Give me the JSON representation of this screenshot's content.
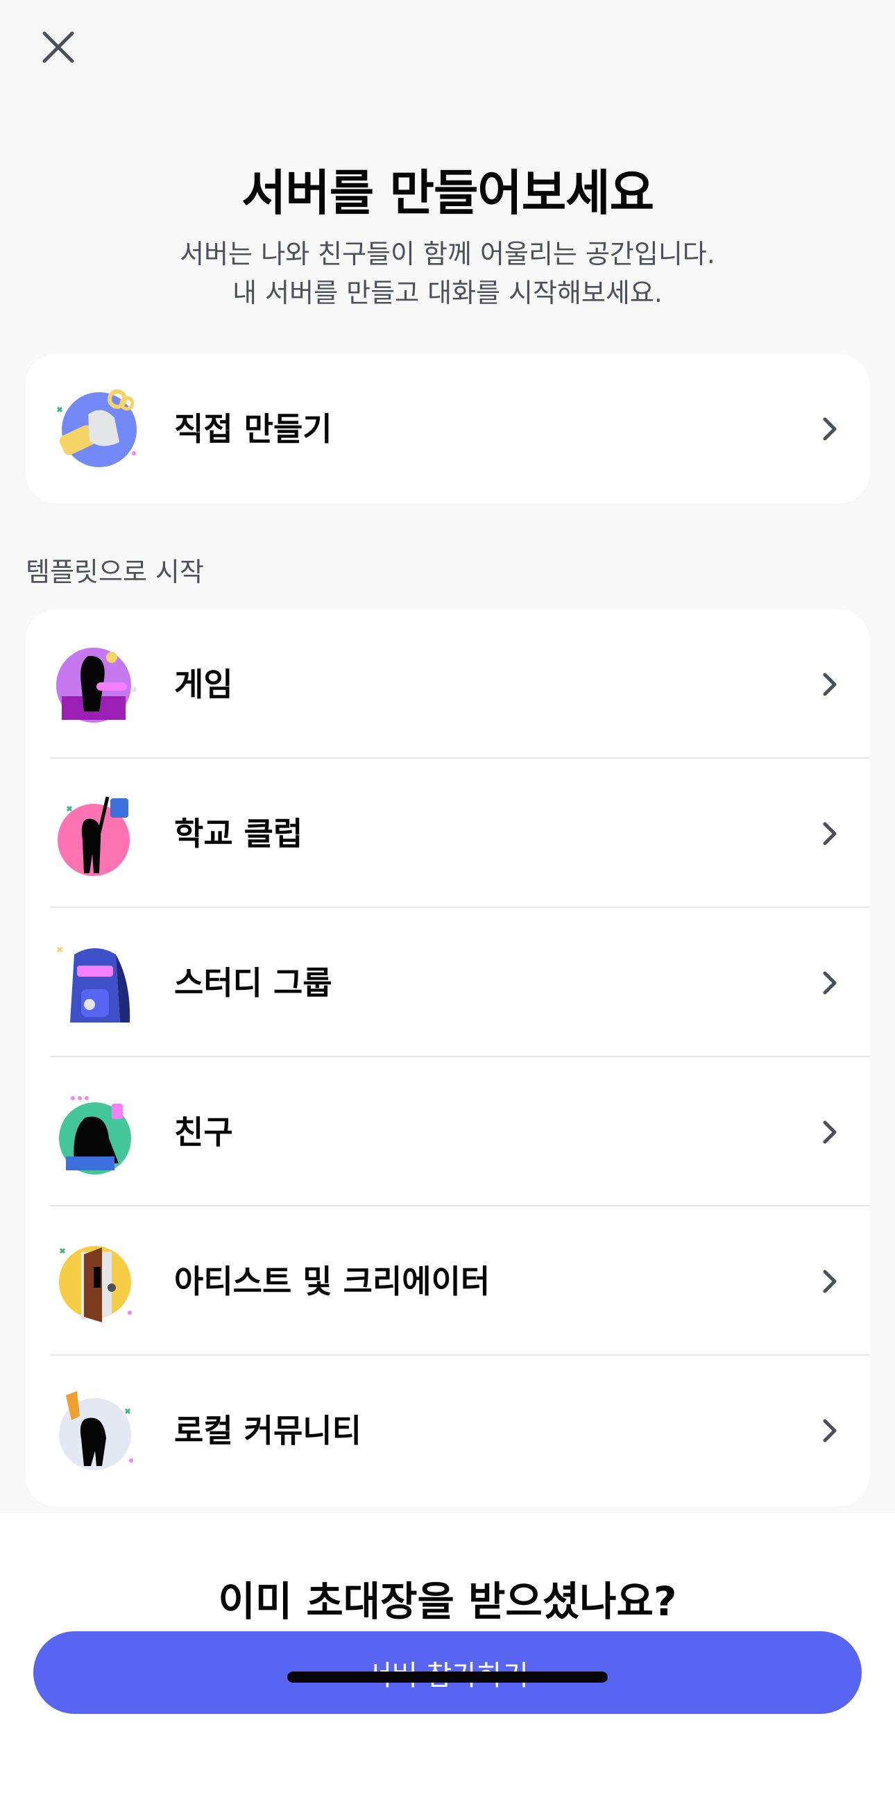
{
  "header": {
    "close_icon": "close-icon",
    "title": "서버를 만들어보세요",
    "subtitle_line1": "서버는 나와 친구들이 함께 어울리는 공간입니다.",
    "subtitle_line2": "내 서버를 만들고 대화를 시작해보세요."
  },
  "create": {
    "label": "직접 만들기",
    "icon": "create-own-illustration-icon"
  },
  "templates": {
    "section_label": "템플릿으로 시작",
    "items": [
      {
        "label": "게임",
        "icon": "gaming-illustration-icon"
      },
      {
        "label": "학교 클럽",
        "icon": "school-club-illustration-icon"
      },
      {
        "label": "스터디 그룹",
        "icon": "study-group-illustration-icon"
      },
      {
        "label": "친구",
        "icon": "friends-illustration-icon"
      },
      {
        "label": "아티스트 및 크리에이터",
        "icon": "artists-creators-illustration-icon"
      },
      {
        "label": "로컬 커뮤니티",
        "icon": "local-community-illustration-icon"
      }
    ]
  },
  "footer": {
    "invite_question": "이미 초대장을 받으셨나요?",
    "join_button_label": "서버 참가하기"
  },
  "colors": {
    "accent": "#5865f2",
    "background": "#f8f8f9",
    "card": "#ffffff",
    "divider": "#e3e5e8"
  }
}
